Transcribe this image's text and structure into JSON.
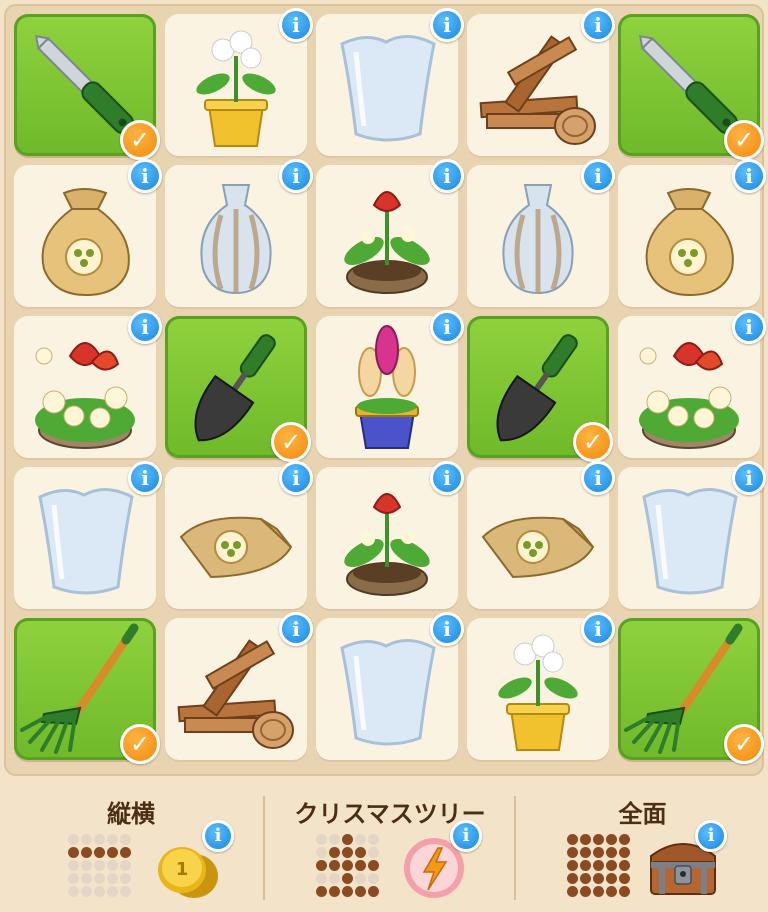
{
  "board": {
    "rows": [
      [
        {
          "item": "garden-knife",
          "done": true
        },
        {
          "item": "white-flower-pot",
          "done": false
        },
        {
          "item": "glass-vase",
          "done": false
        },
        {
          "item": "wood-planks",
          "done": false
        },
        {
          "item": "garden-knife",
          "done": true
        }
      ],
      [
        {
          "item": "seed-sack",
          "done": false
        },
        {
          "item": "striped-vase",
          "done": false
        },
        {
          "item": "tulip-planter",
          "done": false
        },
        {
          "item": "striped-vase",
          "done": false
        },
        {
          "item": "seed-sack",
          "done": false
        }
      ],
      [
        {
          "item": "flower-planter",
          "done": false
        },
        {
          "item": "trowel",
          "done": true
        },
        {
          "item": "hyacinth-pot",
          "done": false
        },
        {
          "item": "trowel",
          "done": true
        },
        {
          "item": "flower-planter",
          "done": false
        }
      ],
      [
        {
          "item": "glass-vase",
          "done": false
        },
        {
          "item": "seed-bag",
          "done": false
        },
        {
          "item": "tulip-planter",
          "done": false
        },
        {
          "item": "seed-bag",
          "done": false
        },
        {
          "item": "glass-vase",
          "done": false
        }
      ],
      [
        {
          "item": "rake",
          "done": true
        },
        {
          "item": "wood-planks",
          "done": false
        },
        {
          "item": "glass-vase",
          "done": false
        },
        {
          "item": "white-flower-pot",
          "done": false
        },
        {
          "item": "rake",
          "done": true
        }
      ]
    ]
  },
  "icons": {
    "info": "i",
    "check": "✓"
  },
  "goals": [
    {
      "title": "縦横",
      "reward_icon": "gold-coin-icon",
      "pattern": [
        0,
        0,
        0,
        0,
        0,
        1,
        1,
        1,
        1,
        1,
        0,
        0,
        0,
        0,
        0,
        0,
        0,
        0,
        0,
        0,
        0,
        0,
        0,
        0,
        0
      ]
    },
    {
      "title": "クリスマスツリー",
      "reward_icon": "energy-orb-icon",
      "pattern": [
        0,
        0,
        1,
        0,
        0,
        0,
        1,
        1,
        1,
        0,
        1,
        1,
        1,
        1,
        1,
        0,
        0,
        1,
        0,
        0,
        1,
        1,
        1,
        1,
        1
      ]
    },
    {
      "title": "全面",
      "reward_icon": "treasure-chest-icon",
      "pattern": [
        1,
        1,
        1,
        1,
        1,
        1,
        1,
        1,
        1,
        1,
        1,
        1,
        1,
        1,
        1,
        1,
        1,
        1,
        1,
        1,
        1,
        1,
        1,
        1,
        1
      ]
    }
  ],
  "colors": {
    "done_tile": "#7cc333",
    "check_orange": "#f39312",
    "info_blue": "#1f8fe6",
    "pattern_on": "#8a4a22",
    "pattern_off": "#e3d6c4"
  }
}
